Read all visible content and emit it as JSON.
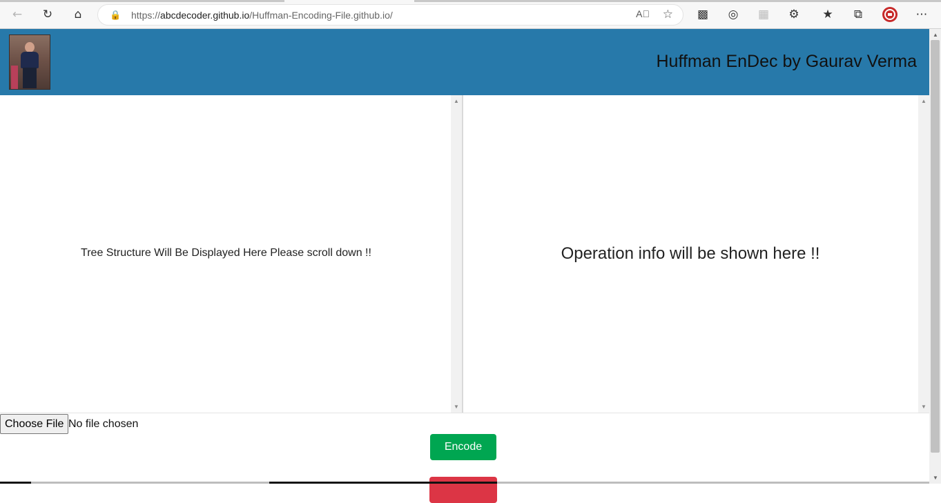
{
  "browser": {
    "url_protocol": "https://",
    "url_host": "abcdecoder.github.io",
    "url_path": "/Huffman-Encoding-File.github.io/",
    "icons": [
      "back-icon",
      "refresh-icon",
      "home-icon",
      "lock-icon",
      "read-aloud-icon",
      "add-favorite-icon",
      "tab-actions-icon",
      "sync-icon",
      "extension-icon",
      "puzzle-icon",
      "favorites-icon",
      "collections-icon",
      "profile-icon",
      "more-icon"
    ]
  },
  "header": {
    "title": "Huffman EnDec by Gaurav Verma",
    "background": "#2779aa"
  },
  "left_pane": {
    "placeholder": "Tree Structure Will Be Displayed Here Please scroll down !!"
  },
  "right_pane": {
    "placeholder": "Operation info will be shown here !!"
  },
  "controls": {
    "file_button_label": "Choose File",
    "file_status": "No file chosen",
    "encode_label": "Encode",
    "encode_color": "#00a651",
    "decode_color": "#dc3545"
  }
}
